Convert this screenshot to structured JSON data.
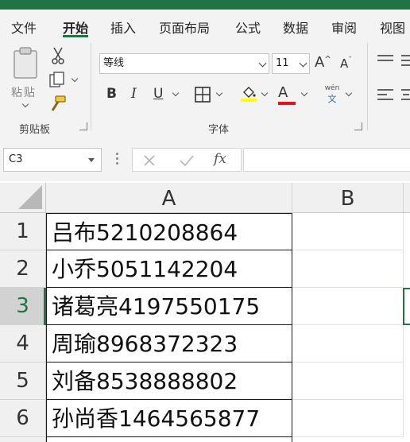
{
  "ribbon_tabs": [
    "文件",
    "开始",
    "插入",
    "页面布局",
    "公式",
    "数据",
    "审阅",
    "视图"
  ],
  "active_tab": "开始",
  "clipboard": {
    "paste_label": "粘贴",
    "group_label": "剪贴板"
  },
  "font": {
    "name": "等线",
    "size": "11",
    "group_label": "字体",
    "bold": "B",
    "italic": "I",
    "underline": "U",
    "font_color_glyph": "A",
    "phonetic_top": "wén",
    "phonetic_bottom": "文",
    "highlight_color": "#ffff00",
    "font_color": "#e81123",
    "grow_glyph": "A",
    "shrink_glyph": "A"
  },
  "name_box": "C3",
  "fx_label": "fx",
  "columns": [
    "A",
    "B"
  ],
  "rows": [
    {
      "num": "1",
      "A": "吕布5210208864"
    },
    {
      "num": "2",
      "A": "小乔5051142204"
    },
    {
      "num": "3",
      "A": "诸葛亮4197550175"
    },
    {
      "num": "4",
      "A": "周瑜8968372323"
    },
    {
      "num": "5",
      "A": "刘备8538888802"
    },
    {
      "num": "6",
      "A": "孙尚香1464565877"
    }
  ],
  "selected_row": "3",
  "accent": "#217346"
}
